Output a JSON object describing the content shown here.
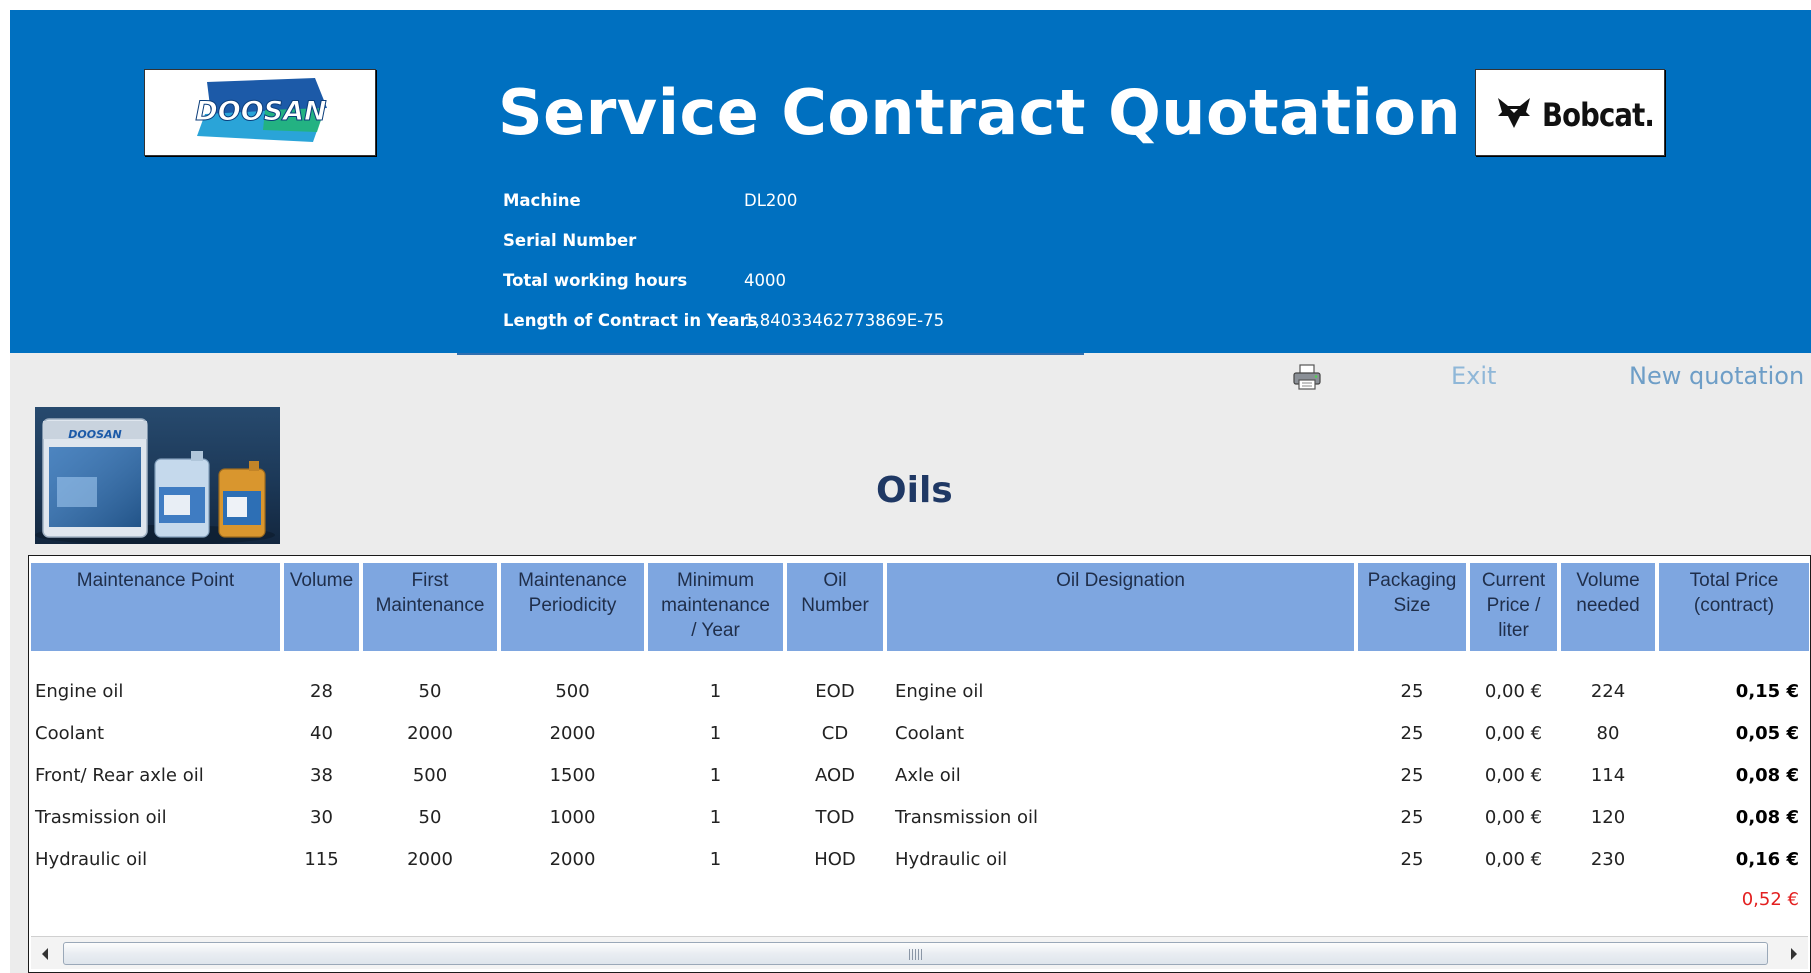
{
  "header": {
    "title": "Service Contract Quotation",
    "logo_left_text": "DOOSAN",
    "logo_right_text": "Bobcat.",
    "colors": {
      "band": "#0070c0",
      "text": "#ffffff"
    }
  },
  "info": [
    {
      "label": "Machine",
      "value": "DL200"
    },
    {
      "label": "Serial Number",
      "value": ""
    },
    {
      "label": "Total working hours",
      "value": "4000"
    },
    {
      "label": "Length of Contract in Years",
      "value": "1,84033462773869E-75"
    }
  ],
  "toolbar": {
    "print_icon": "printer-icon",
    "exit_label": "Exit",
    "new_quotation_label": "New quotation"
  },
  "product_image": {
    "bucket_label": "DOOSAN"
  },
  "section": {
    "title": "Oils"
  },
  "table": {
    "headers": [
      [
        "Maintenance Point"
      ],
      [
        "Volume"
      ],
      [
        "First",
        "Maintenance"
      ],
      [
        "Maintenance",
        "Periodicity"
      ],
      [
        "Minimum",
        "maintenance",
        "/ Year"
      ],
      [
        "Oil",
        "Number"
      ],
      [
        "Oil Designation"
      ],
      [
        "Packaging",
        "Size"
      ],
      [
        "Current",
        "Price /",
        "liter"
      ],
      [
        "Volume",
        "needed"
      ],
      [
        "Total Price",
        "(contract)"
      ]
    ],
    "rows": [
      [
        "Engine oil",
        "28",
        "50",
        "500",
        "1",
        "EOD",
        "Engine oil",
        "25",
        "0,00 €",
        "224",
        "0,15 €"
      ],
      [
        "Coolant",
        "40",
        "2000",
        "2000",
        "1",
        "CD",
        "Coolant",
        "25",
        "0,00 €",
        "80",
        "0,05 €"
      ],
      [
        "Front/ Rear axle oil",
        "38",
        "500",
        "1500",
        "1",
        "AOD",
        "Axle oil",
        "25",
        "0,00 €",
        "114",
        "0,08 €"
      ],
      [
        "Trasmission oil",
        "30",
        "50",
        "1000",
        "1",
        "TOD",
        "Transmission oil",
        "25",
        "0,00 €",
        "120",
        "0,08 €"
      ],
      [
        "Hydraulic oil",
        "115",
        "2000",
        "2000",
        "1",
        "HOD",
        "Hydraulic oil",
        "25",
        "0,00 €",
        "230",
        "0,16 €"
      ]
    ],
    "grand_total": "0,52 €",
    "colors": {
      "header_bg": "#7ea6e0",
      "total": "#e32020"
    }
  }
}
